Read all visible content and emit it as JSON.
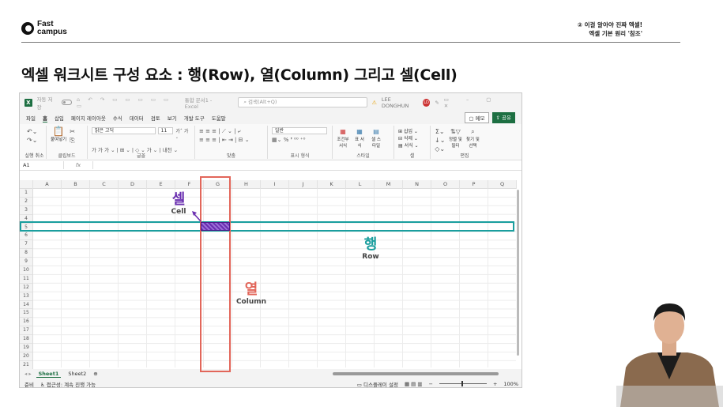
{
  "header": {
    "logo_line1": "Fast",
    "logo_line2": "campus",
    "series_line1": "② 이걸 알아야 진짜 엑셀!",
    "series_line2": "엑셀 기본 원리 '참조'"
  },
  "slide_title": "엑셀 워크시트 구성 요소 : 행(Row), 열(Column) 그리고 셀(Cell)",
  "excel": {
    "autosave_label": "자동 저장",
    "doc_title": "통합 문서1 - Excel",
    "search_placeholder": "검색(Alt+Q)",
    "user_name": "LEE DONGHUN",
    "user_initials": "LD",
    "menu": [
      "파일",
      "홈",
      "삽입",
      "페이지 레이아웃",
      "수식",
      "데이터",
      "검토",
      "보기",
      "개발 도구",
      "도움말"
    ],
    "active_menu": "홈",
    "memo_label": "메모",
    "share_label": "공유",
    "ribbon": {
      "undo_label": "실행 취소",
      "clipboard_label": "클립보드",
      "paste_label": "붙여넣기",
      "font_label": "글꼴",
      "font_name": "맑은 고딕",
      "font_size": "11",
      "align_label": "맞춤",
      "number_label": "표시 형식",
      "number_format": "일반",
      "style_label": "스타일",
      "cond_format": "조건부 서식",
      "table_format": "표 서식",
      "cell_style": "셀 스타일",
      "cells_label": "셀",
      "insert": "삽입",
      "delete": "삭제",
      "format": "서식",
      "edit_label": "편집",
      "sort_filter": "정렬 및 필터",
      "find_select": "찾기 및 선택"
    },
    "name_box": "A1",
    "fx": "fx",
    "columns": [
      "A",
      "B",
      "C",
      "D",
      "E",
      "F",
      "G",
      "H",
      "I",
      "J",
      "K",
      "L",
      "M",
      "N",
      "O",
      "P",
      "Q"
    ],
    "rows": [
      "1",
      "2",
      "3",
      "4",
      "5",
      "6",
      "7",
      "8",
      "9",
      "10",
      "11",
      "12",
      "13",
      "14",
      "15",
      "16",
      "17",
      "18",
      "19",
      "20",
      "21"
    ],
    "sheets": [
      "Sheet1",
      "Sheet2"
    ],
    "active_sheet": "Sheet1",
    "status_ready": "준비",
    "accessibility": "접근성: 계속 진행 가능",
    "display_settings": "디스플레이 설정",
    "zoom": "100%"
  },
  "annotations": {
    "cell_ko": "셀",
    "cell_en": "Cell",
    "row_ko": "행",
    "row_en": "Row",
    "col_ko": "열",
    "col_en": "Column"
  },
  "colors": {
    "row_accent": "#1a9e9e",
    "col_accent": "#e2665a",
    "cell_accent": "#6a2fb0",
    "excel_green": "#1d6f42"
  }
}
